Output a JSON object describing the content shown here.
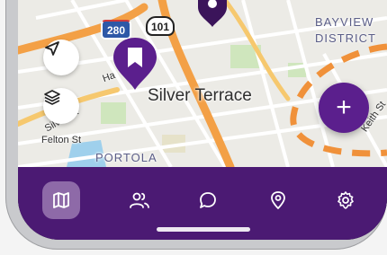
{
  "map": {
    "neighborhood_label": "Silver Terrace",
    "district_label_line1": "BAYVIEW",
    "district_label_line2": "DISTRICT",
    "portola_label": "PORTOLA",
    "street_felton": "Felton St",
    "street_silver": "Silver St",
    "street_ha": "Ha",
    "street_keith": "Keith St",
    "shield_280": "280",
    "shield_101": "101"
  },
  "controls": {
    "locate_icon": "navigation-arrow-icon",
    "layers_icon": "layers-icon",
    "add_label": "+"
  },
  "tabbar": {
    "items": [
      {
        "name": "map",
        "icon": "map-icon",
        "active": true
      },
      {
        "name": "people",
        "icon": "people-icon",
        "active": false
      },
      {
        "name": "chat",
        "icon": "chat-bubble-icon",
        "active": false
      },
      {
        "name": "location",
        "icon": "location-pin-icon",
        "active": false
      },
      {
        "name": "settings",
        "icon": "gear-icon",
        "active": false
      }
    ]
  },
  "colors": {
    "brand_purple": "#4b1a73",
    "fab_purple": "#5b1f8d",
    "active_tab": "#8e6aa8",
    "route_orange": "#f0913a"
  }
}
